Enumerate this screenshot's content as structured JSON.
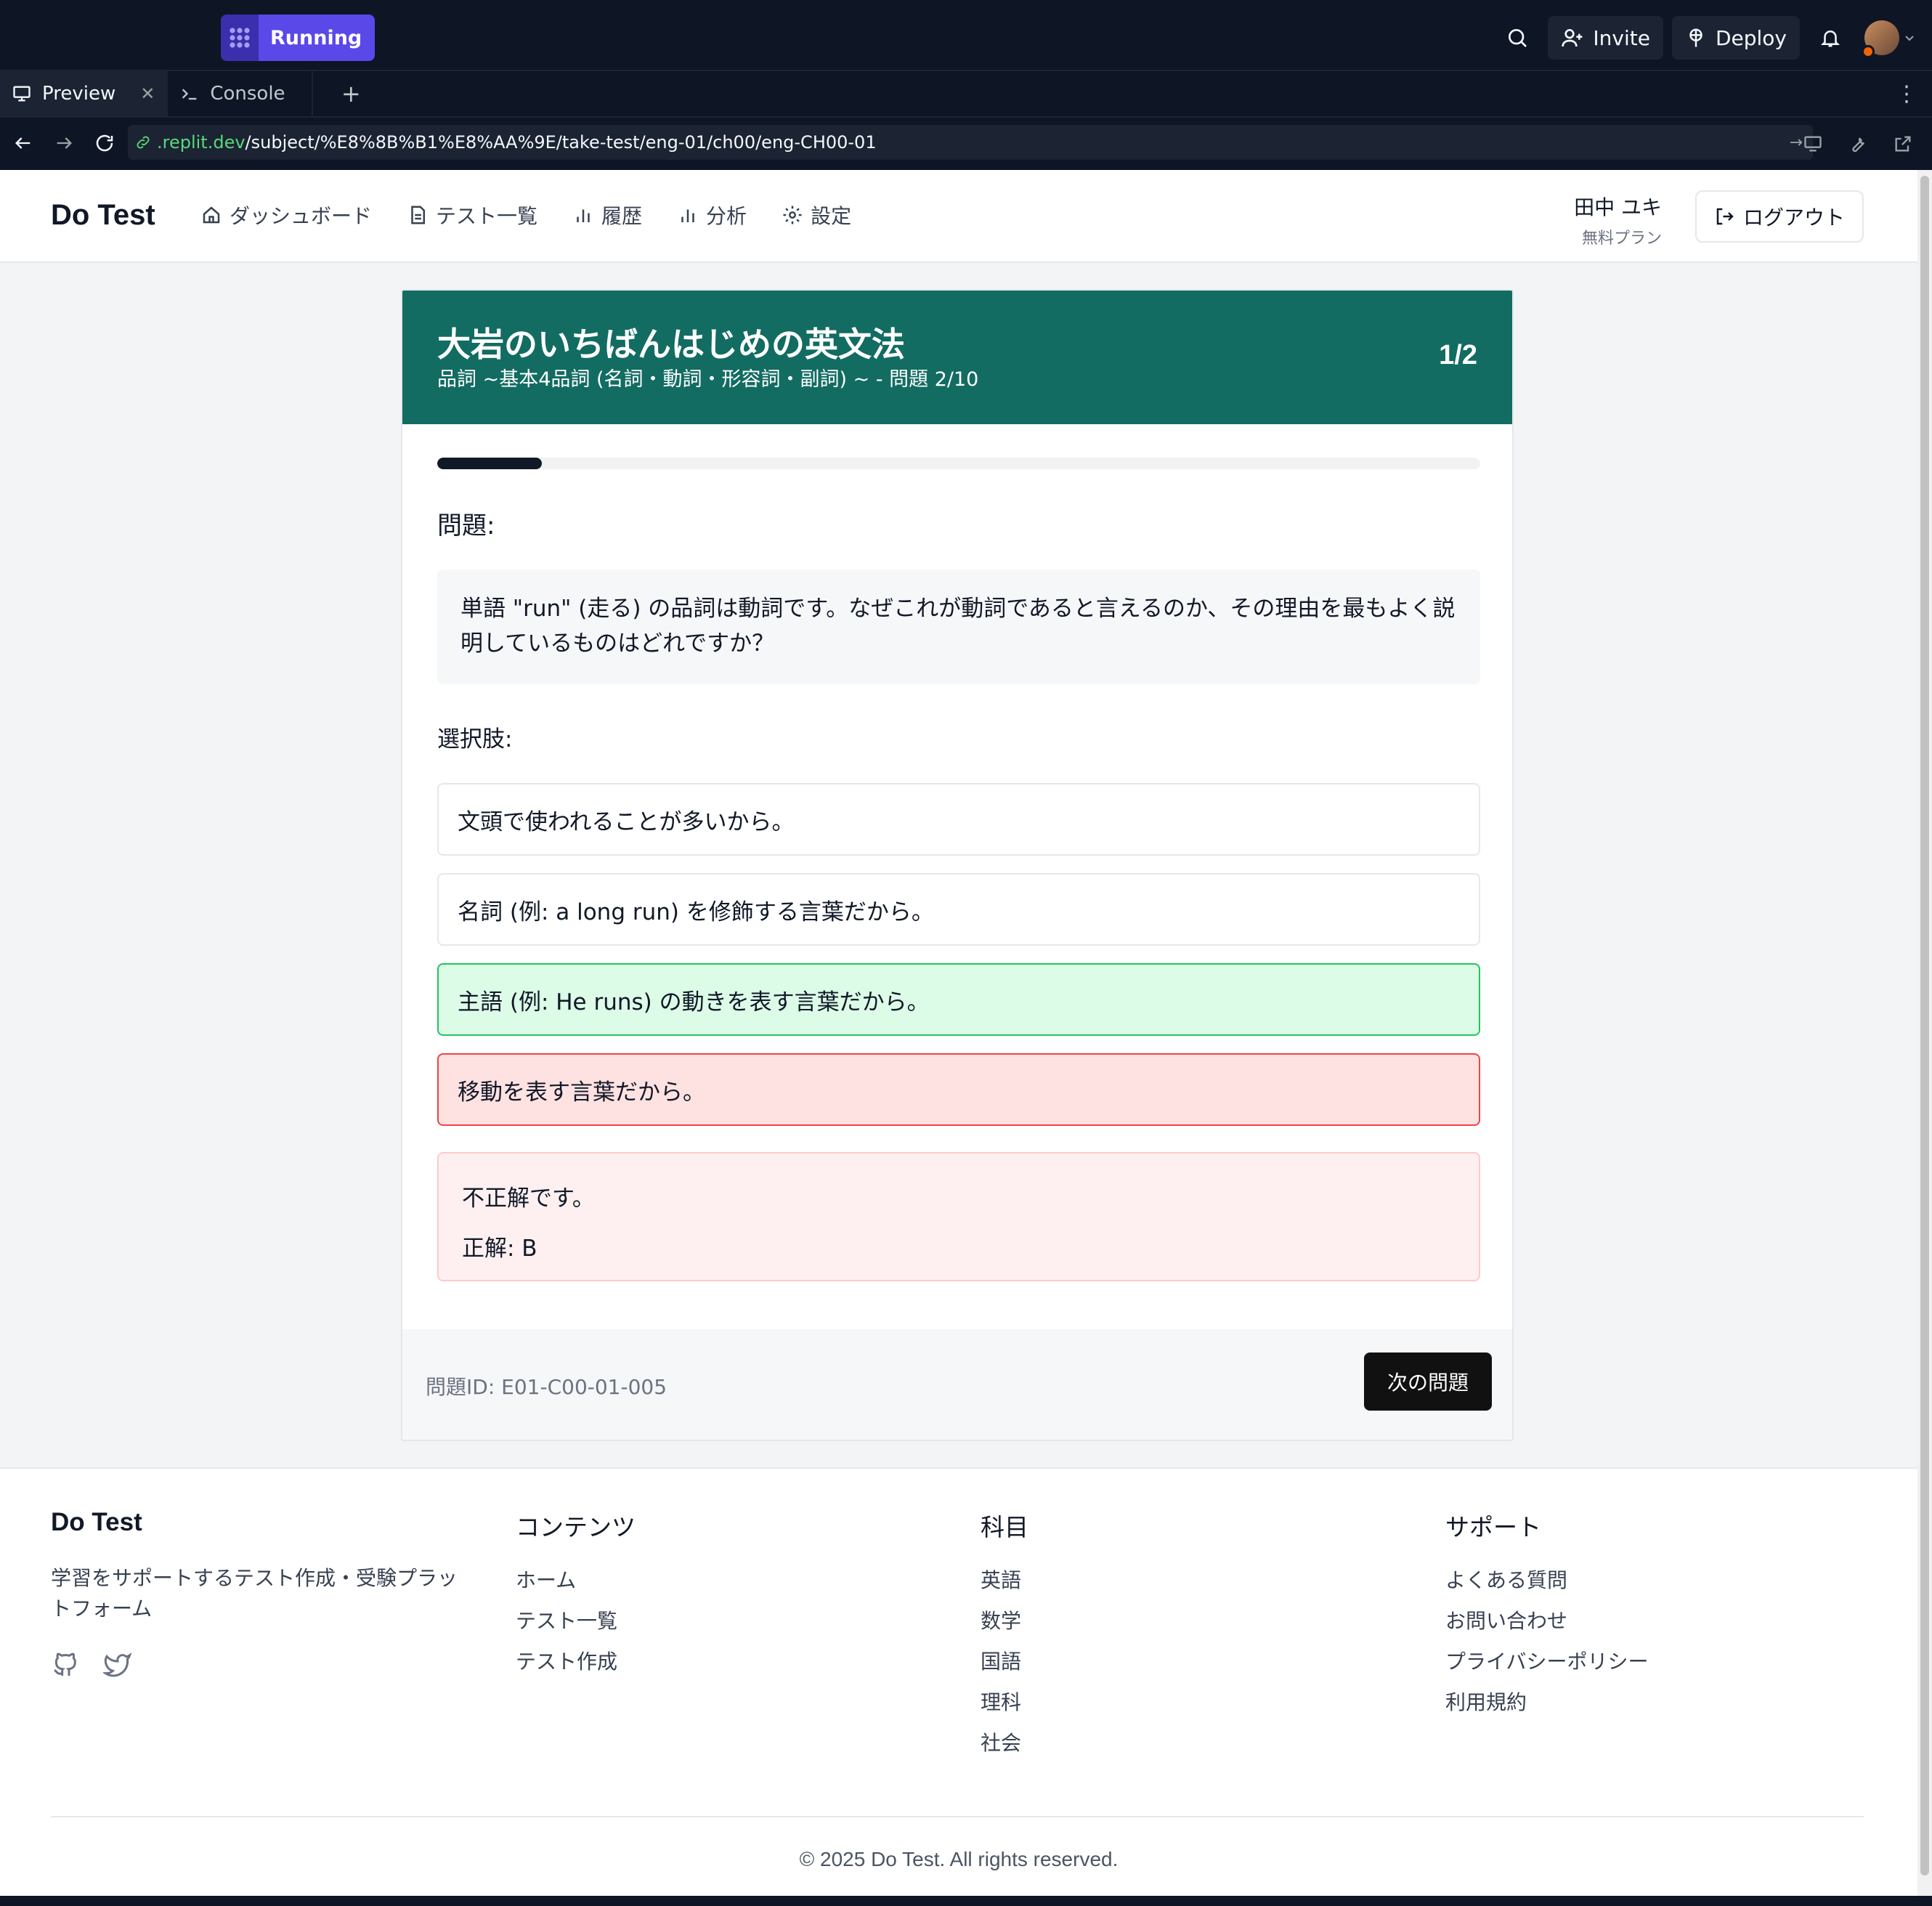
{
  "ide": {
    "run_status": "Running",
    "invite_label": "Invite",
    "deploy_label": "Deploy",
    "tabs": [
      {
        "label": "Preview",
        "icon": "monitor-icon"
      },
      {
        "label": "Console",
        "icon": "terminal-icon"
      }
    ],
    "url": {
      "host": ".replit.dev",
      "path": "/subject/%E8%8B%B1%E8%AA%9E/take-test/eng-01/ch00/eng-CH00-01"
    }
  },
  "site": {
    "brand": "Do Test",
    "nav": [
      {
        "label": "ダッシュボード",
        "icon": "home-icon"
      },
      {
        "label": "テスト一覧",
        "icon": "document-icon"
      },
      {
        "label": "履歴",
        "icon": "bar-chart-icon"
      },
      {
        "label": "分析",
        "icon": "bar-chart-icon"
      },
      {
        "label": "設定",
        "icon": "gear-icon"
      }
    ],
    "user": {
      "name": "田中 ユキ",
      "plan": "無料プラン"
    },
    "logout_label": "ログアウト"
  },
  "test": {
    "title": "大岩のいちばんはじめの英文法",
    "subtitle": "品詞 ~基本4品詞 (名詞・動詞・形容詞・副詞) ~ - 問題 2/10",
    "counter": "1/2",
    "progress": 0.1,
    "question_label": "問題:",
    "question_text": "単語 \"run\" (走る) の品詞は動詞です。なぜこれが動詞であると言えるのか、その理由を最もよく説明しているものはどれですか？",
    "choices_label": "選択肢:",
    "choices": [
      {
        "text": "文頭で使われることが多いから。",
        "state": "default"
      },
      {
        "text": "名詞 (例: a long run) を修飾する言葉だから。",
        "state": "default"
      },
      {
        "text": "主語 (例: He runs) の動きを表す言葉だから。",
        "state": "correct"
      },
      {
        "text": "移動を表す言葉だから。",
        "state": "wrong"
      }
    ],
    "feedback": {
      "result": "不正解です。",
      "answer": "正解: B"
    },
    "question_id": "問題ID: E01-C00-01-005",
    "next_label": "次の問題"
  },
  "footer": {
    "brand": "Do Test",
    "description": "学習をサポートするテスト作成・受験プラットフォーム",
    "columns": [
      {
        "title": "コンテンツ",
        "links": [
          "ホーム",
          "テスト一覧",
          "テスト作成"
        ]
      },
      {
        "title": "科目",
        "links": [
          "英語",
          "数学",
          "国語",
          "理科",
          "社会"
        ]
      },
      {
        "title": "サポート",
        "links": [
          "よくある質問",
          "お問い合わせ",
          "プライバシーポリシー",
          "利用規約"
        ]
      }
    ],
    "copyright": "© 2025 Do Test. All rights reserved."
  }
}
